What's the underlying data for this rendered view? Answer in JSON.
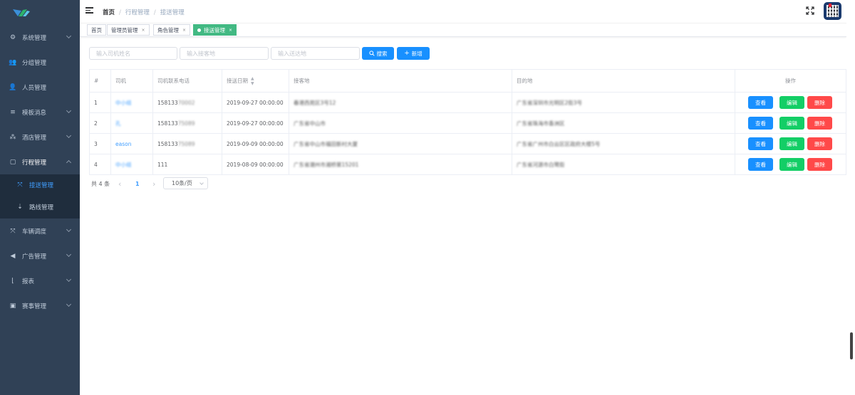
{
  "sidebar": {
    "logo_text": "",
    "items": [
      {
        "label": "系统管理",
        "icon": "gear-icon",
        "glyph": "⚙"
      },
      {
        "label": "分组管理",
        "icon": "users-icon",
        "glyph": "👥"
      },
      {
        "label": "人员管理",
        "icon": "user-icon",
        "glyph": "👤"
      },
      {
        "label": "模板消息",
        "icon": "list-icon",
        "glyph": "≡"
      },
      {
        "label": "酒店管理",
        "icon": "tree-icon",
        "glyph": "⁂"
      },
      {
        "label": "行程管理",
        "icon": "briefcase-icon",
        "glyph": "▢"
      },
      {
        "label": "接送管理",
        "icon": "swap-icon",
        "glyph": "⤧"
      },
      {
        "label": "路线管理",
        "icon": "route-icon",
        "glyph": "⇣"
      },
      {
        "label": "车辆调度",
        "icon": "swap-icon",
        "glyph": "⤧"
      },
      {
        "label": "广告管理",
        "icon": "megaphone-icon",
        "glyph": "◀"
      },
      {
        "label": "报表",
        "icon": "chart-icon",
        "glyph": "⌊"
      },
      {
        "label": "赛事管理",
        "icon": "trophy-icon",
        "glyph": "▣"
      }
    ]
  },
  "breadcrumb": {
    "home": "首页",
    "parent": "行程管理",
    "current": "接送管理",
    "separator": "/"
  },
  "tags": [
    {
      "label": "首页"
    },
    {
      "label": "管理员管理",
      "close": "×"
    },
    {
      "label": "角色管理",
      "close": "×"
    },
    {
      "label": "接送管理",
      "close": "×"
    }
  ],
  "filters": {
    "driver_name_placeholder": "输入司机姓名",
    "pickup_placeholder": "输入接客地",
    "dropoff_placeholder": "输入送达地",
    "search_label": "搜索",
    "add_label": "新增"
  },
  "table": {
    "headers": [
      "#",
      "司机",
      "司机联系电话",
      "接送日期",
      "接客地",
      "目的地",
      "操作"
    ],
    "rows": [
      {
        "idx": "1",
        "driver": "中小组",
        "phone": "158133",
        "phone_tail": "70002",
        "date": "2019-09-27 00:00:00",
        "pickup": "春港西苑区3号12",
        "dest": "广东省深圳市光明区2街3号"
      },
      {
        "idx": "2",
        "driver": "孔",
        "phone": "158133",
        "phone_tail": "75089",
        "date": "2019-09-27 00:00:00",
        "pickup": "广东省中山市",
        "dest": "广东省珠海市香洲区"
      },
      {
        "idx": "3",
        "driver": "eason",
        "phone": "158133",
        "phone_tail": "75089",
        "date": "2019-09-09 00:00:00",
        "pickup": "广东省中山市福田新村大厦",
        "dest": "广东省广州市白云区区政府大楼5号"
      },
      {
        "idx": "4",
        "driver": "中小组",
        "phone": "111",
        "phone_tail": "",
        "date": "2019-08-09 00:00:00",
        "pickup": "广东省潮州市湘桥第15201",
        "dest": "广东省河源市白鹭街"
      }
    ],
    "actions": {
      "view": "查看",
      "edit": "编辑",
      "delete": "删除"
    }
  },
  "pagination": {
    "total": "共 4 条",
    "prev": "‹",
    "page": "1",
    "next": "›",
    "size": "10条/页"
  },
  "colors": {
    "sidebar": "#304156",
    "primary": "#1890ff",
    "success": "#13ce66",
    "danger": "#ff4949",
    "tag_active": "#42b983"
  }
}
